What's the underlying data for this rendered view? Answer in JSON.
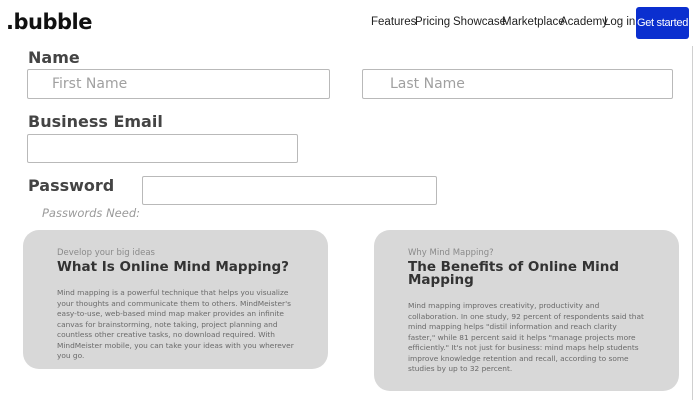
{
  "nav": {
    "logo": ".bubble",
    "links": [
      {
        "label": "Features"
      },
      {
        "label": "Pricing"
      },
      {
        "label": "Showcase"
      },
      {
        "label": "Marketplace"
      },
      {
        "label": "Academy"
      },
      {
        "label": "Log in"
      }
    ],
    "cta_label": "Get started",
    "cta_color": "#0b2fcf"
  },
  "form": {
    "name_label": "Name",
    "first_name_placeholder": "First Name",
    "last_name_placeholder": "Last Name",
    "email_label": "Business Email",
    "password_label": "Password",
    "password_hint": "Passwords Need:"
  },
  "cards": [
    {
      "eyebrow": "Develop your big ideas",
      "title": "What Is Online Mind Mapping?",
      "body": "Mind mapping is a powerful technique that helps you visualize your thoughts and communicate them to others. MindMeister's easy-to-use, web-based mind map maker provides an infinite canvas for brainstorming, note taking, project planning and countless other creative tasks, no download required. With MindMeister mobile, you can take your ideas with you wherever you go."
    },
    {
      "eyebrow": "Why Mind Mapping?",
      "title": "The Benefits of Online Mind Mapping",
      "body": "Mind mapping improves creativity, productivity and collaboration. In one study, 92 percent of respondents said that mind mapping helps \"distil information and reach clarity faster,\" while 81 percent said it helps \"manage projects more efficiently.\" It's not just for business: mind maps help students improve knowledge retention and recall, according to some studies by up to 32 percent."
    }
  ],
  "colors": {
    "card_background": "#d8d8d8"
  }
}
